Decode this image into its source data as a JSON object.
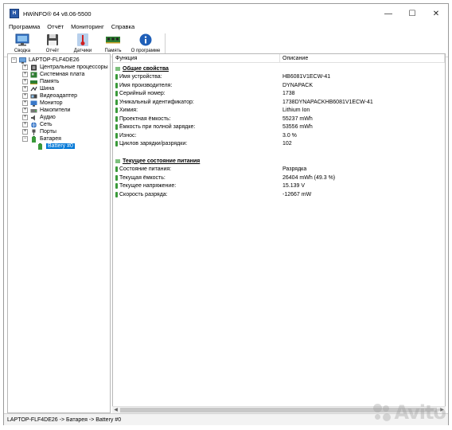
{
  "window": {
    "title": "HWiNFO® 64 v8.06-5500",
    "controls": {
      "minimize": "—",
      "maximize": "☐",
      "close": "✕"
    }
  },
  "menu": [
    "Программа",
    "Отчёт",
    "Мониторинг",
    "Справка"
  ],
  "toolbar": [
    {
      "label": "Сводка",
      "icon": "monitor-icon"
    },
    {
      "label": "Отчёт",
      "icon": "save-disk-icon"
    },
    {
      "label": "Датчики",
      "icon": "thermometer-icon"
    },
    {
      "label": "Память",
      "icon": "memory-module-icon"
    },
    {
      "label": "О программе",
      "icon": "info-icon"
    }
  ],
  "tree": {
    "root": "LAPTOP-FLF4DE26",
    "items": [
      {
        "label": "Центральные процессоры",
        "expander": "+"
      },
      {
        "label": "Системная плата",
        "expander": "+"
      },
      {
        "label": "Память",
        "expander": "+"
      },
      {
        "label": "Шина",
        "expander": "+"
      },
      {
        "label": "Видеоадаптер",
        "expander": "+"
      },
      {
        "label": "Монитор",
        "expander": "+"
      },
      {
        "label": "Накопители",
        "expander": "+"
      },
      {
        "label": "Аудио",
        "expander": "+"
      },
      {
        "label": "Сеть",
        "expander": "+"
      },
      {
        "label": "Порты",
        "expander": "+"
      },
      {
        "label": "Батарея",
        "expander": "−"
      }
    ],
    "selected": "Battery #0"
  },
  "columns": {
    "function": "Функция",
    "description": "Описание"
  },
  "sections": [
    {
      "title": "Общие свойства",
      "rows": [
        {
          "name": "Имя устройства:",
          "value": "HB6081V1ECW-41"
        },
        {
          "name": "Имя производителя:",
          "value": "DYNAPACK"
        },
        {
          "name": "Серийный номер:",
          "value": "1738"
        },
        {
          "name": "Уникальный идентификатор:",
          "value": "1738DYNAPACKHB6081V1ECW-41"
        },
        {
          "name": "Химия:",
          "value": "Lithium Ion"
        },
        {
          "name": "Проектная ёмкость:",
          "value": "55237 mWh"
        },
        {
          "name": "Ёмкость при полной зарядке:",
          "value": "53556 mWh"
        },
        {
          "name": "Износ:",
          "value": "3.0 %"
        },
        {
          "name": "Циклов зарядки/разрядки:",
          "value": "102"
        }
      ]
    },
    {
      "title": "Текущее состояние питания",
      "rows": [
        {
          "name": "Состояние питания:",
          "value": "Разрядка"
        },
        {
          "name": "Текущая ёмкость:",
          "value": "26404 mWh (49.3 %)"
        },
        {
          "name": "Текущее напряжение:",
          "value": "15.139 V"
        },
        {
          "name": "Скорость разряда:",
          "value": "-12667 mW"
        }
      ]
    }
  ],
  "statusbar": "LAPTOP-FLF4DE26 -> Батарея -> Battery #0",
  "watermark": "Avito"
}
